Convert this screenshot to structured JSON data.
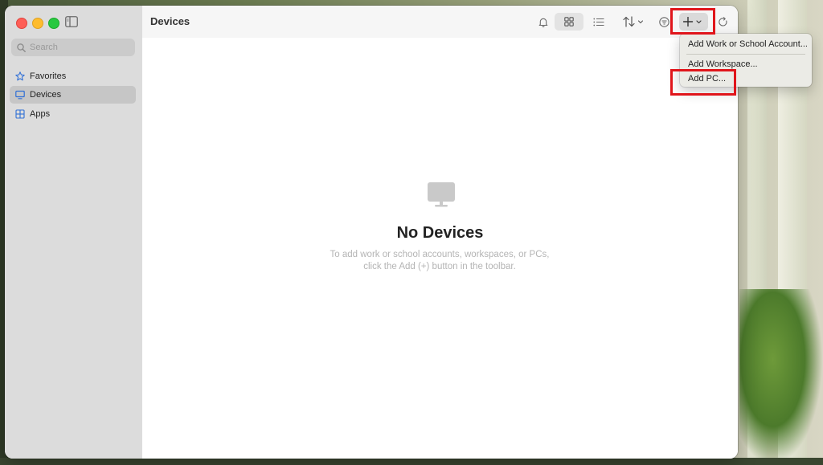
{
  "window": {
    "title": "Devices"
  },
  "sidebar": {
    "search_placeholder": "Search",
    "items": [
      {
        "label": "Favorites",
        "icon": "star-icon",
        "active": false
      },
      {
        "label": "Devices",
        "icon": "monitor-icon",
        "active": true
      },
      {
        "label": "Apps",
        "icon": "apps-grid-icon",
        "active": false
      }
    ]
  },
  "toolbar": {
    "buttons": [
      "bell-icon",
      "grid-view-icon",
      "list-view-icon",
      "sort-icon",
      "filter-icon",
      "add-icon",
      "refresh-icon"
    ]
  },
  "add_menu": {
    "items": [
      {
        "label": "Add Work or School Account..."
      },
      {
        "label": "Add Workspace..."
      },
      {
        "label": "Add PC..."
      }
    ]
  },
  "empty_state": {
    "title": "No Devices",
    "description_line1": "To add work or school accounts, workspaces, or PCs,",
    "description_line2": "click the Add (+) button in the toolbar."
  },
  "colors": {
    "accent": "#2f6fd6",
    "highlight": "#e0151b"
  }
}
